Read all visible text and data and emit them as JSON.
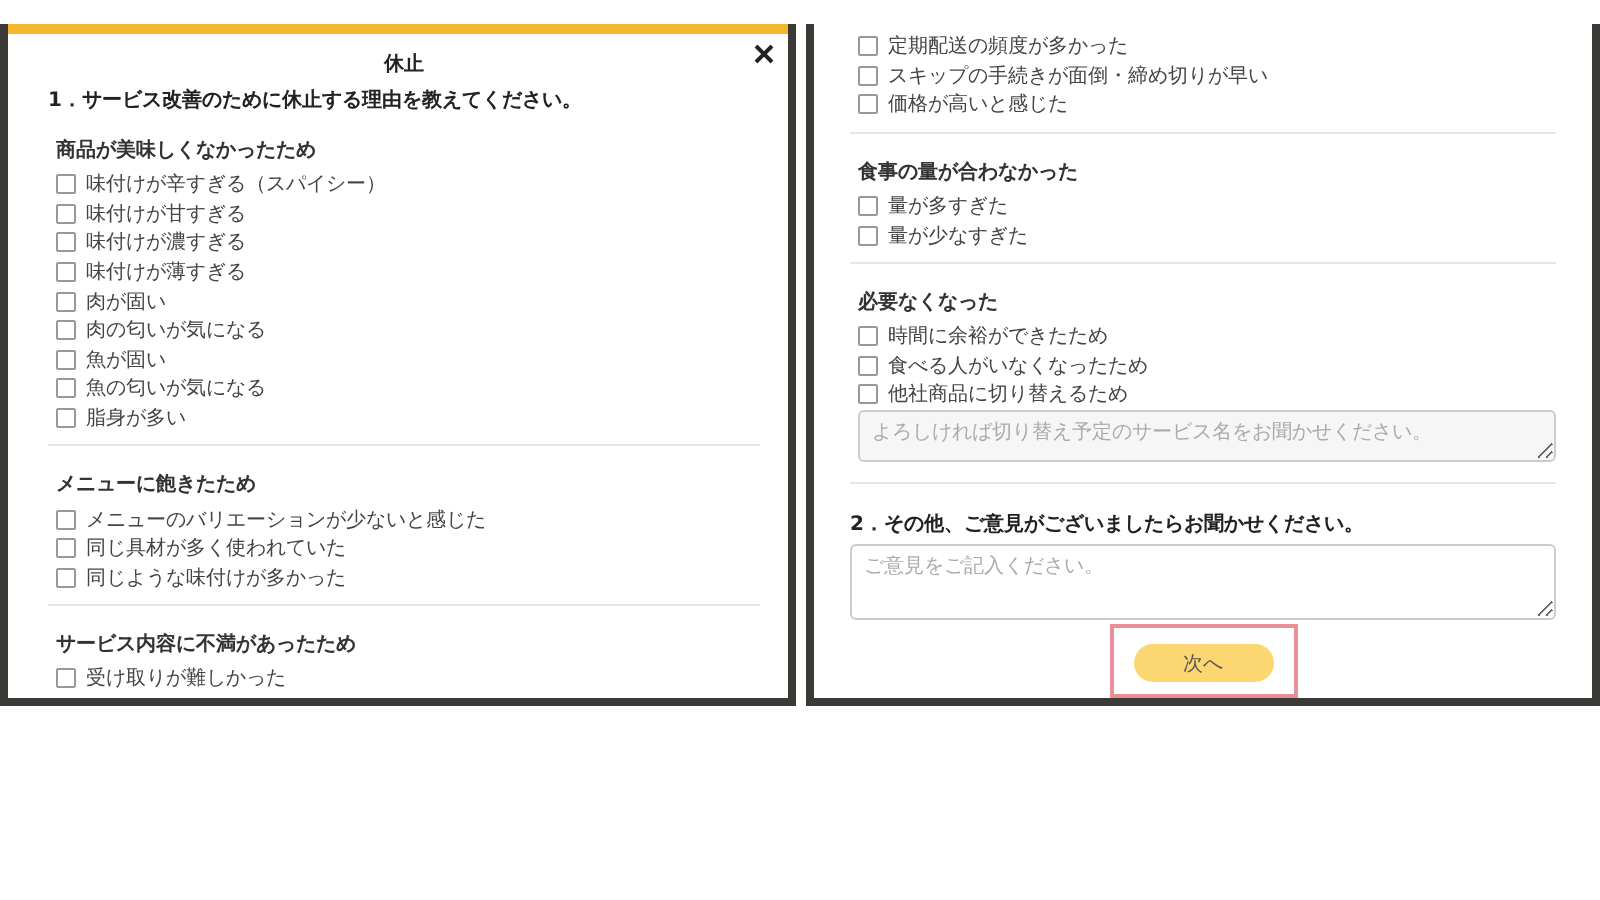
{
  "left_screen": {
    "title": "休止",
    "question": "1．サービス改善のために休止する理由を教えてください。",
    "sections": [
      {
        "heading": "商品が美味しくなかったため",
        "options": [
          {
            "label": "味付けが辛すぎる（スパイシー）",
            "checked": false
          },
          {
            "label": "味付けが甘すぎる",
            "checked": false
          },
          {
            "label": "味付けが濃すぎる",
            "checked": false
          },
          {
            "label": "味付けが薄すぎる",
            "checked": false
          },
          {
            "label": "肉が固い",
            "checked": false
          },
          {
            "label": "肉の匂いが気になる",
            "checked": false
          },
          {
            "label": "魚が固い",
            "checked": false
          },
          {
            "label": "魚の匂いが気になる",
            "checked": false
          },
          {
            "label": "脂身が多い",
            "checked": false
          }
        ]
      },
      {
        "heading": "メニューに飽きたため",
        "options": [
          {
            "label": "メニューのバリエーションが少ないと感じた",
            "checked": false
          },
          {
            "label": "同じ具材が多く使われていた",
            "checked": false
          },
          {
            "label": "同じような味付けが多かった",
            "checked": false
          }
        ]
      },
      {
        "heading": "サービス内容に不満があったため",
        "options": [
          {
            "label": "受け取りが難しかった",
            "checked": false
          }
        ]
      }
    ]
  },
  "right_screen": {
    "sections": [
      {
        "options": [
          {
            "label": "定期配送の頻度が多かった",
            "checked": false
          },
          {
            "label": "スキップの手続きが面倒・締め切りが早い",
            "checked": false
          },
          {
            "label": "価格が高いと感じた",
            "checked": false
          }
        ]
      },
      {
        "heading": "食事の量が合わなかった",
        "options": [
          {
            "label": "量が多すぎた",
            "checked": false
          },
          {
            "label": "量が少なすぎた",
            "checked": false
          }
        ]
      },
      {
        "heading": "必要なくなった",
        "options": [
          {
            "label": "時間に余裕ができたため",
            "checked": false
          },
          {
            "label": "食べる人がいなくなったため",
            "checked": false
          },
          {
            "label": "他社商品に切り替えるため",
            "checked": false
          }
        ],
        "detail_placeholder": "よろしければ切り替え予定のサービス名をお聞かせください。"
      }
    ],
    "question": "2．その他、ご意見がございましたらお聞かせください。",
    "comment_placeholder": "ご意見をご記入ください。",
    "button": {
      "label": "次へ",
      "highlighted": true
    }
  }
}
